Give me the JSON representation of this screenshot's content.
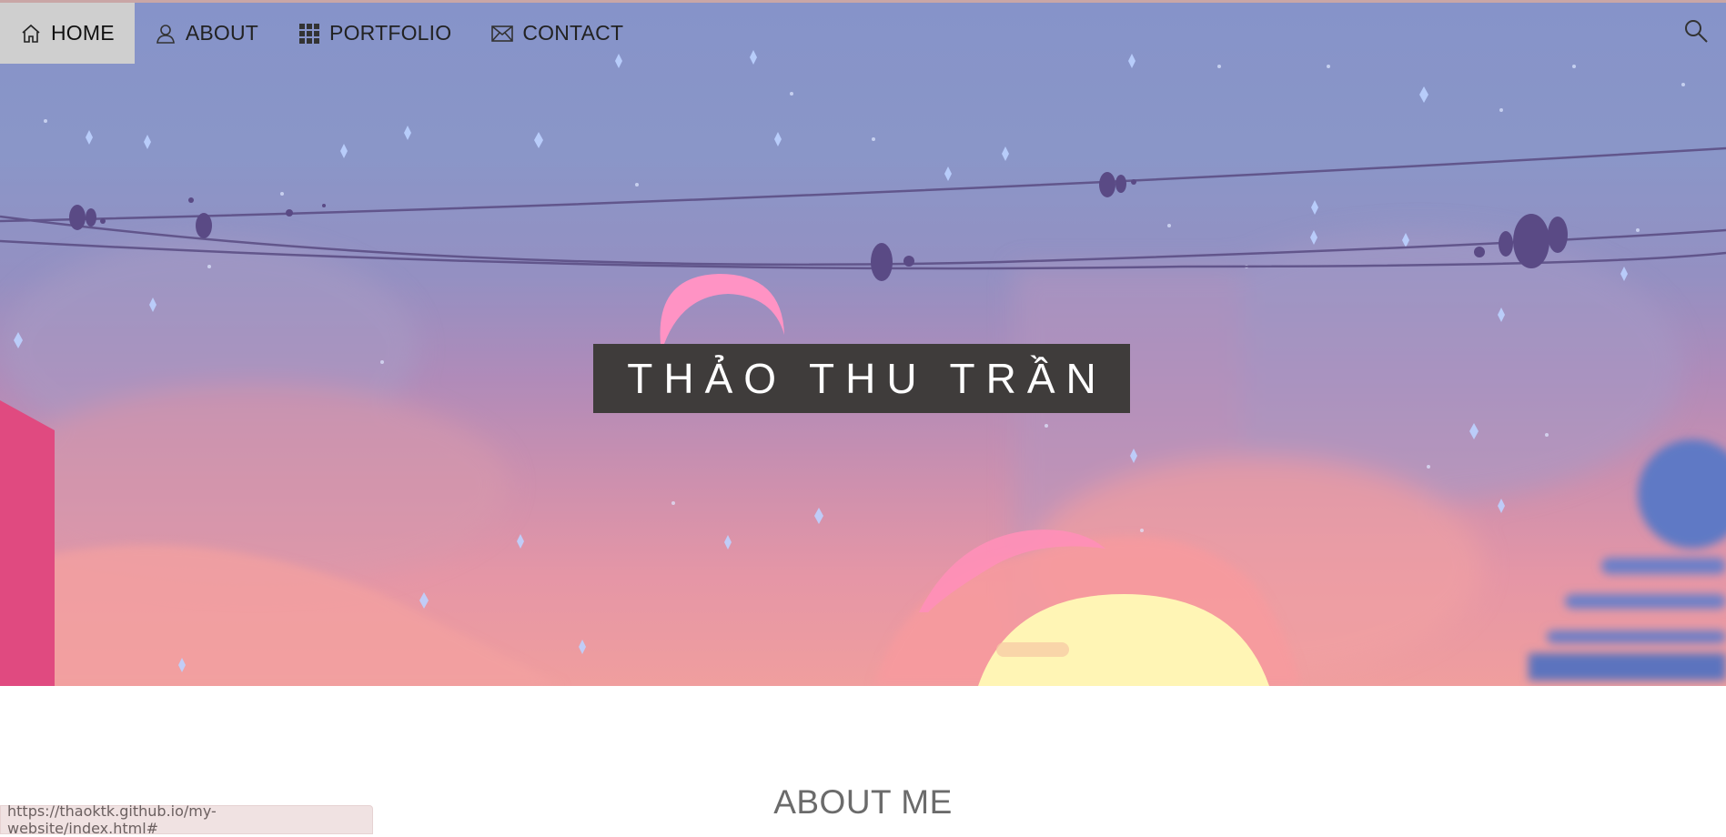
{
  "nav": {
    "items": [
      {
        "label": "HOME",
        "icon": "home-icon",
        "active": true
      },
      {
        "label": "ABOUT",
        "icon": "user-icon",
        "active": false
      },
      {
        "label": "PORTFOLIO",
        "icon": "grid-icon",
        "active": false
      },
      {
        "label": "CONTACT",
        "icon": "envelope-icon",
        "active": false
      }
    ],
    "search_icon": "search-icon"
  },
  "hero": {
    "title": "THẢO THU TRẦN"
  },
  "about": {
    "heading": "ABOUT ME"
  },
  "status_bar": {
    "url": "https://thaoktk.github.io/my-website/index.html#"
  },
  "colors": {
    "nav_active_bg": "#cfcfcf",
    "title_bg": "#3f3c3b",
    "sky_top": "#8693c9",
    "sky_bottom": "#f09e9e"
  }
}
